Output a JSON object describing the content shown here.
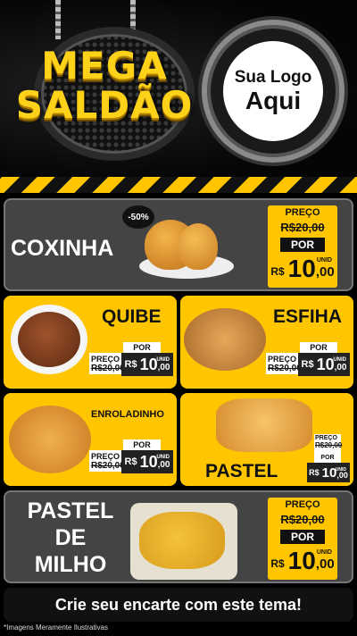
{
  "header": {
    "title_line1": "MEGA",
    "title_line2": "SALDÃO",
    "logo_line1": "Sua Logo",
    "logo_line2": "Aqui"
  },
  "colors": {
    "accent": "#ffc600",
    "dark": "#111111",
    "panel_gray": "#444444"
  },
  "products": {
    "coxinha": {
      "name": "COXINHA",
      "discount": "-50%",
      "price_label": "PREÇO",
      "old_price": "R$20,00",
      "por": "POR",
      "currency": "R$",
      "price_int": "10",
      "price_dec": ",00",
      "unit": "UNID"
    },
    "quibe": {
      "name": "QUIBE",
      "price_label": "PREÇO",
      "old_price": "R$20,00",
      "por": "POR",
      "currency": "R$",
      "price_int": "10",
      "price_dec": ",00",
      "unit": "UNID"
    },
    "esfiha": {
      "name": "ESFIHA",
      "price_label": "PREÇO",
      "old_price": "R$20,00",
      "por": "POR",
      "currency": "R$",
      "price_int": "10",
      "price_dec": ",00",
      "unit": "UNID"
    },
    "enroladinho": {
      "name": "ENROLADINHO",
      "price_label": "PREÇO",
      "old_price": "R$20,00",
      "por": "POR",
      "currency": "R$",
      "price_int": "10",
      "price_dec": ",00",
      "unit": "UNID"
    },
    "pastel": {
      "name": "PASTEL",
      "price_label": "PREÇO",
      "old_price": "R$20,00",
      "por": "POR",
      "currency": "R$",
      "price_int": "10",
      "price_dec": ",00",
      "unit": "UNID"
    },
    "pastel_milho": {
      "name_line1": "PASTEL",
      "name_line2": "DE",
      "name_line3": "MILHO",
      "price_label": "PREÇO",
      "old_price": "R$20,00",
      "por": "POR",
      "currency": "R$",
      "price_int": "10",
      "price_dec": ",00",
      "unit": "UNID"
    }
  },
  "cta": "Crie seu encarte com este tema!",
  "footnote": "*Imagens Meramente Ilustrativas"
}
